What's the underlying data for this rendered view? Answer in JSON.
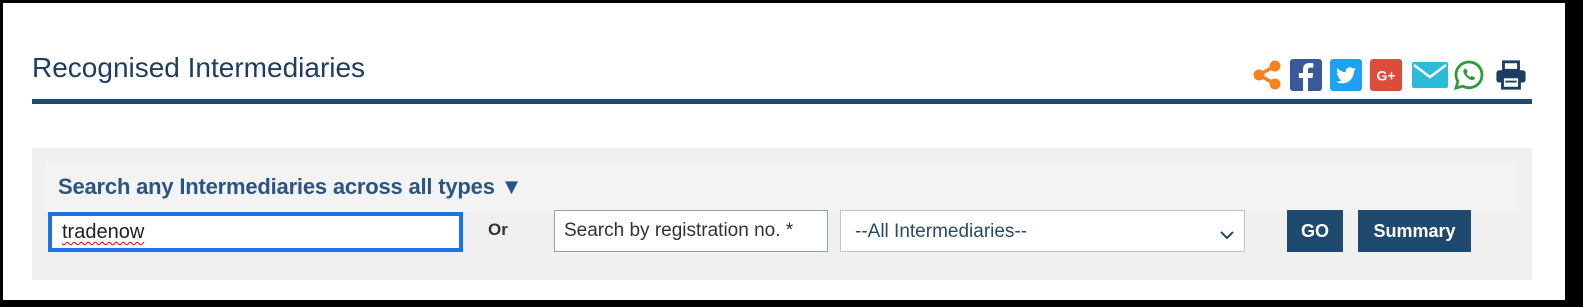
{
  "page": {
    "title": "Recognised Intermediaries"
  },
  "share": {
    "icons": [
      "share-icon",
      "facebook-icon",
      "twitter-icon",
      "google-plus-icon",
      "email-icon",
      "whatsapp-icon",
      "print-icon"
    ],
    "colors": {
      "share": "#f58220",
      "facebook": "#3b5998",
      "twitter": "#1da1f2",
      "google_plus": "#dd4b39",
      "email": "#2bbbd8",
      "whatsapp": "#2a9d3a",
      "print": "#1d3d63"
    },
    "google_plus_label": "G+"
  },
  "search": {
    "heading": "Search any Intermediaries across all types ▼",
    "name_value": "tradenow",
    "or_label": "Or",
    "registration_placeholder": "Search by registration no. *",
    "type_select_value": "--All Intermediaries--",
    "go_label": "GO",
    "summary_label": "Summary"
  },
  "colors": {
    "accent": "#1e4a70",
    "title": "#1d3d63",
    "focus": "#1a73e8"
  }
}
